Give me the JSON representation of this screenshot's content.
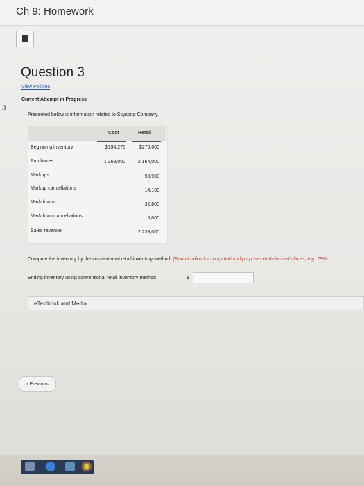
{
  "header": {
    "course_title": "Ch 9: Homework"
  },
  "menu": {
    "icon": "menu-icon"
  },
  "side_mark": "J",
  "question": {
    "title": "Question 3",
    "view_policies": "View Policies",
    "attempt_status": "Current Attempt in Progress",
    "intro": "Presented below is information related to Skysong Company."
  },
  "table": {
    "columns": [
      "Cost",
      "Retail"
    ],
    "rows": [
      {
        "label": "Beginning inventory",
        "cost": "$194,276",
        "retail": "$276,000"
      },
      {
        "label": "Purchases",
        "cost": "1,368,000",
        "retail": "2,164,000"
      },
      {
        "label": "Markups",
        "cost": "",
        "retail": "93,900"
      },
      {
        "label": "Markup cancellations",
        "cost": "",
        "retail": "14,100"
      },
      {
        "label": "Markdowns",
        "cost": "",
        "retail": "32,800"
      },
      {
        "label": "Markdown cancellations",
        "cost": "",
        "retail": "5,000"
      },
      {
        "label": "Sales revenue",
        "cost": "",
        "retail": "2,239,000"
      }
    ]
  },
  "prompt": {
    "text": "Compute the inventory by the conventional retail inventory method.",
    "note": "(Round ratios for computational purposes to 0 decimal places, e.g. 78%"
  },
  "answer": {
    "label": "Ending inventory using conventional retail inventory method",
    "currency": "$",
    "value": "",
    "placeholder": ""
  },
  "etextbook": {
    "label": "eTextbook and Media"
  },
  "nav": {
    "previous": "Previous"
  },
  "colors": {
    "link": "#2a5aa8",
    "note": "#c0392b",
    "taskbar": "#2a3a52"
  },
  "taskbar_icons": [
    "start-icon",
    "edge-browser-icon",
    "store-icon",
    "chrome-icon"
  ]
}
